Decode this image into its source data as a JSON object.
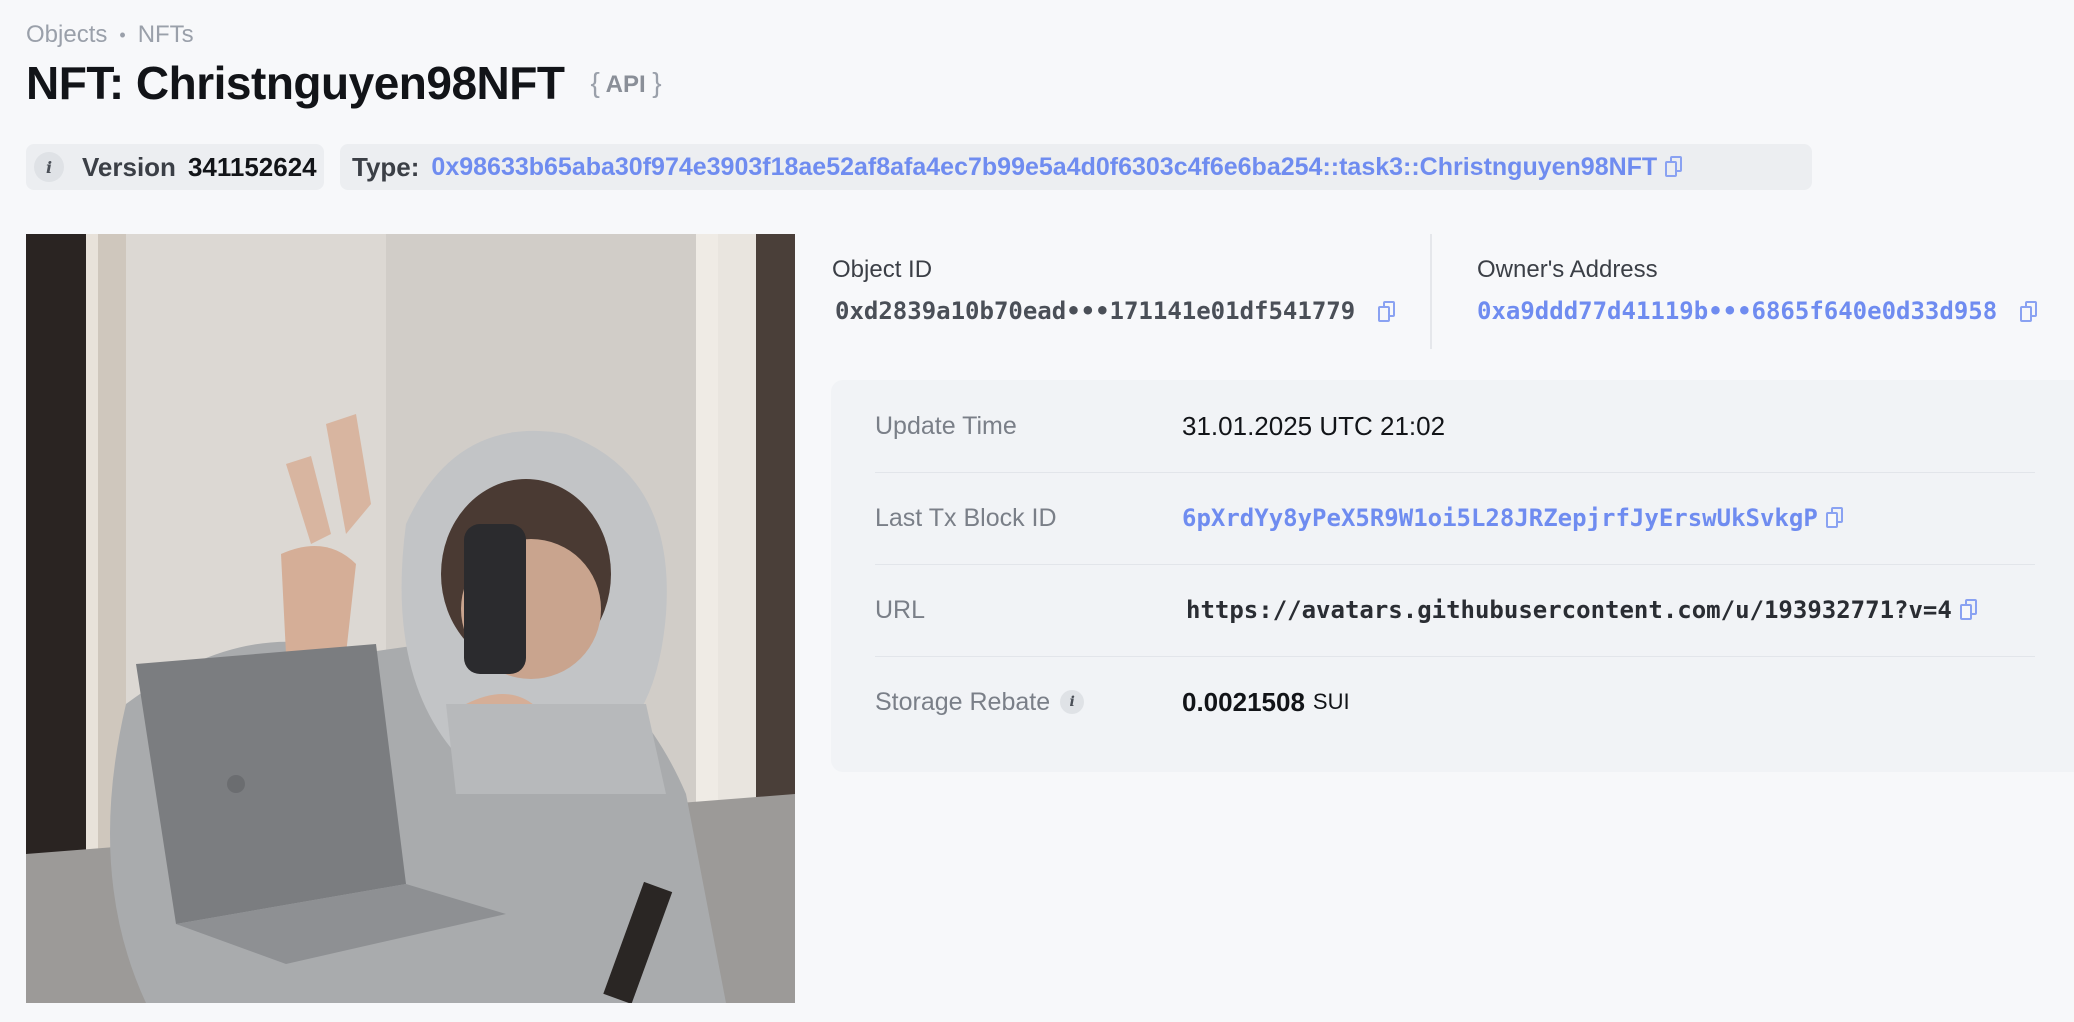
{
  "breadcrumb": {
    "first": "Objects",
    "separator": "•",
    "second": "NFTs"
  },
  "header": {
    "title": "NFT: Christnguyen98NFT",
    "api_label": "API",
    "api_open": "{",
    "api_close": "}"
  },
  "version": {
    "label": "Version",
    "value": "341152624"
  },
  "type": {
    "label": "Type:",
    "value": "0x98633b65aba30f974e3903f18ae52af8afa4ec7b99e5a4d0f6303c4f6e6ba254::task3::Christnguyen98NFT"
  },
  "object_id": {
    "label": "Object ID",
    "value": "0xd2839a10b70ead•••171141e01df541779"
  },
  "owner": {
    "label": "Owner's Address",
    "value": "0xa9ddd77d41119b•••6865f640e0d33d958"
  },
  "details": {
    "update_time": {
      "label": "Update Time",
      "value": "31.01.2025 UTC 21:02"
    },
    "last_tx": {
      "label": "Last Tx Block ID",
      "value": "6pXrdYy8yPeX5R9W1oi5L28JRZepjrfJyErswUkSvkgP"
    },
    "url": {
      "label": "URL",
      "value": "https://avatars.githubusercontent.com/u/193932771?v=4"
    },
    "storage_rebate": {
      "label": "Storage Rebate",
      "value": "0.0021508",
      "unit": "SUI"
    }
  },
  "icons": {
    "info": "i",
    "copy": "copy-icon",
    "photo": "nft-image"
  },
  "colors": {
    "accent": "#6f8cf0",
    "background": "#f7f8fa",
    "card": "#f1f3f6"
  }
}
